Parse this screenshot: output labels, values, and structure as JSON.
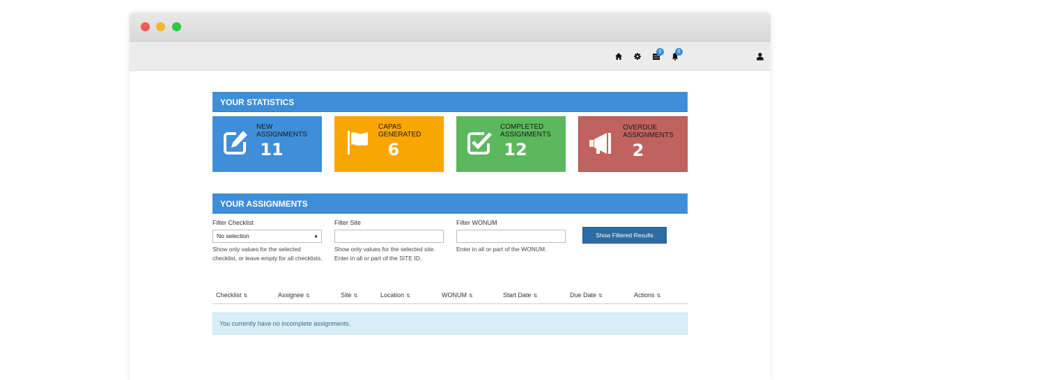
{
  "navbar": {
    "messages_count": "0",
    "notifications_count": "0"
  },
  "statistics": {
    "title": "YOUR STATISTICS",
    "tiles": [
      {
        "label": "NEW ASSIGNMENTS",
        "value": "11",
        "icon": "edit-icon",
        "color": "#3f8ed9"
      },
      {
        "label": "CAPAS GENERATED",
        "value": "6",
        "icon": "flag-icon",
        "color": "#f9a602"
      },
      {
        "label": "COMPLETED ASSIGNMENTS",
        "value": "12",
        "icon": "checkbox-icon",
        "color": "#5cb85c"
      },
      {
        "label": "OVERDUE ASSIGNMENTS",
        "value": "2",
        "icon": "megaphone-icon",
        "color": "#c1625f"
      }
    ]
  },
  "assignments": {
    "title": "YOUR ASSIGNMENTS",
    "filters": {
      "checklist": {
        "label": "Filter Checklist",
        "value": "No selection",
        "help": "Show only values for the selected checklist, or leave empty for all checklists."
      },
      "site": {
        "label": "Filter Site",
        "value": "",
        "help": "Show only values for the selected site. Enter in all or part of the SITE ID."
      },
      "wonum": {
        "label": "Filter WONUM",
        "value": "",
        "help": "Enter in all or part of the WONUM."
      }
    },
    "show_button": "Show Filtered Results",
    "columns": [
      "Checklist",
      "Assignee",
      "Site",
      "Location",
      "WONUM",
      "Start Date",
      "Due Date",
      "Actions"
    ],
    "empty_message": "You currently have no incomplete assignments."
  }
}
